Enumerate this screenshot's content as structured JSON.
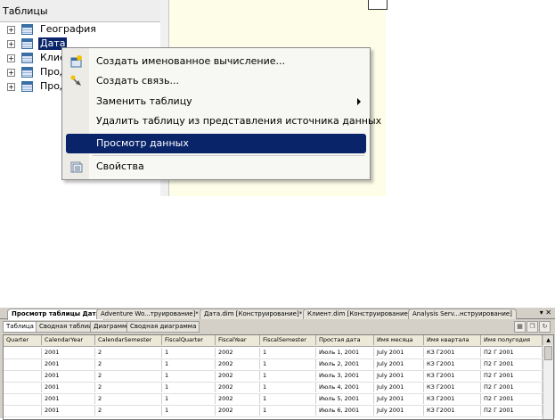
{
  "tree": {
    "header": "Таблицы",
    "items": [
      {
        "label": "География",
        "selected": false
      },
      {
        "label": "Дата",
        "selected": true
      },
      {
        "label": "Клие",
        "selected": false
      },
      {
        "label": "Прод",
        "selected": false
      },
      {
        "label": "Прод",
        "selected": false
      }
    ],
    "expander_glyph": "+"
  },
  "context_menu": {
    "items": [
      {
        "label": "Создать именованное вычисление...",
        "icon": "named-calculation-icon"
      },
      {
        "label": "Создать связь...",
        "icon": "new-relationship-icon"
      },
      {
        "label": "Заменить таблицу",
        "submenu": true
      },
      {
        "label": "Удалить таблицу из представления источника данных"
      },
      {
        "label": "Просмотр данных",
        "highlighted": true
      },
      {
        "label": "Свойства",
        "icon": "properties-icon"
      }
    ]
  },
  "viewer": {
    "doc_tabs": [
      {
        "label": "Просмотр таблицы Дата",
        "active": true
      },
      {
        "label": "Adventure Wo...труирование]*"
      },
      {
        "label": "Дата.dim [Конструирование]*"
      },
      {
        "label": "Клиент.dim [Конструирование]"
      },
      {
        "label": "Analysis Serv...нструирование]"
      }
    ],
    "tab_tools": "▾ ✕",
    "sub_tabs": [
      {
        "label": "Таблица",
        "active": true
      },
      {
        "label": "Сводная таблица"
      },
      {
        "label": "Диаграмма"
      },
      {
        "label": "Сводная диаграмма"
      }
    ],
    "columns": [
      "Quarter",
      "CalendarYear",
      "CalendarSemester",
      "FiscalQuarter",
      "FiscalYear",
      "FiscalSemester",
      "Простая дата",
      "Имя месяца",
      "Имя квартала",
      "Имя полугодия"
    ],
    "rows": [
      [
        "",
        "2001",
        "2",
        "1",
        "2002",
        "1",
        "Июль 1, 2001",
        "July 2001",
        "КЗ Г2001",
        "П2 Г 2001"
      ],
      [
        "",
        "2001",
        "2",
        "1",
        "2002",
        "1",
        "Июль 2, 2001",
        "July 2001",
        "КЗ Г2001",
        "П2 Г 2001"
      ],
      [
        "",
        "2001",
        "2",
        "1",
        "2002",
        "1",
        "Июль 3, 2001",
        "July 2001",
        "КЗ Г2001",
        "П2 Г 2001"
      ],
      [
        "",
        "2001",
        "2",
        "1",
        "2002",
        "1",
        "Июль 4, 2001",
        "July 2001",
        "КЗ Г2001",
        "П2 Г 2001"
      ],
      [
        "",
        "2001",
        "2",
        "1",
        "2002",
        "1",
        "Июль 5, 2001",
        "July 2001",
        "КЗ Г2001",
        "П2 Г 2001"
      ],
      [
        "",
        "2001",
        "2",
        "1",
        "2002",
        "1",
        "Июль 6, 2001",
        "July 2001",
        "КЗ Г2001",
        "П2 Г 2001"
      ]
    ]
  },
  "colors": {
    "selection": "#0a246a",
    "canvas": "#fdfde8",
    "menu_bg": "#f7f7f4"
  }
}
